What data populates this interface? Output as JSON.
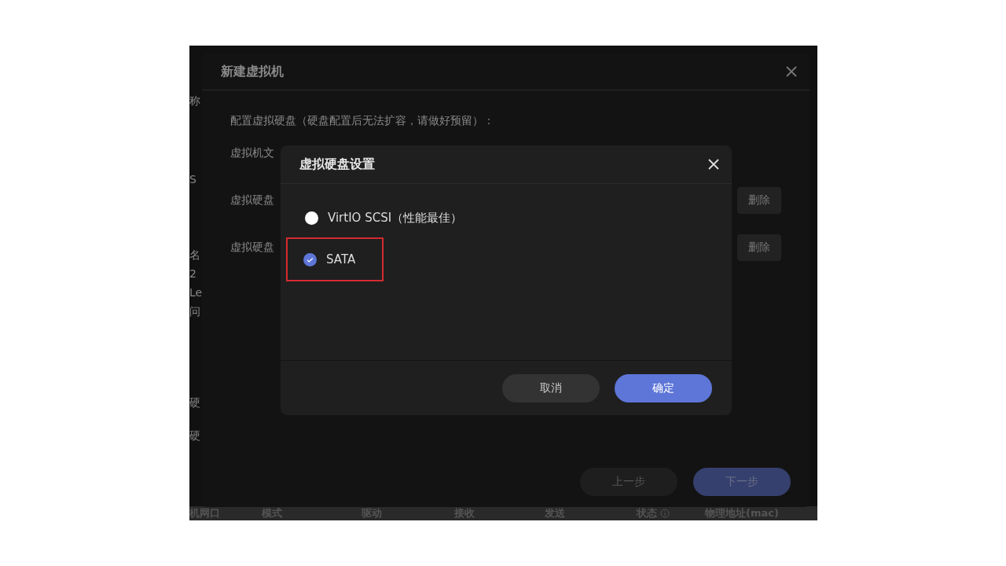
{
  "background": {
    "side_labels": [
      "称",
      "S",
      "名",
      "2",
      "Le",
      "问",
      "硬",
      "硬"
    ],
    "table_header": [
      {
        "label": "机网口",
        "info": false
      },
      {
        "label": "模式",
        "info": false
      },
      {
        "label": "驱动",
        "info": false
      },
      {
        "label": "接收",
        "info": false
      },
      {
        "label": "发送",
        "info": false
      },
      {
        "label": "状态",
        "info": true
      },
      {
        "label": "物理地址(mac)",
        "info": false
      }
    ]
  },
  "outer_dialog": {
    "title": "新建虚拟机",
    "intro": "配置虚拟硬盘（硬盘配置后无法扩容，请做好预留）：",
    "fields": [
      {
        "label": "虚拟机文"
      },
      {
        "label": "虚拟硬盘",
        "action": "删除"
      },
      {
        "label": "虚拟硬盘",
        "action": "删除"
      }
    ],
    "buttons": [
      {
        "label": "上一步",
        "kind": "secondary"
      },
      {
        "label": "下一步",
        "kind": "primary"
      }
    ]
  },
  "inner_dialog": {
    "title": "虚拟硬盘设置",
    "options": [
      {
        "label": "VirtIO SCSI（性能最佳）",
        "selected": false,
        "highlighted": false
      },
      {
        "label": "SATA",
        "selected": true,
        "highlighted": true
      }
    ],
    "buttons": [
      {
        "label": "取消",
        "kind": "secondary"
      },
      {
        "label": "确定",
        "kind": "primary"
      }
    ]
  }
}
